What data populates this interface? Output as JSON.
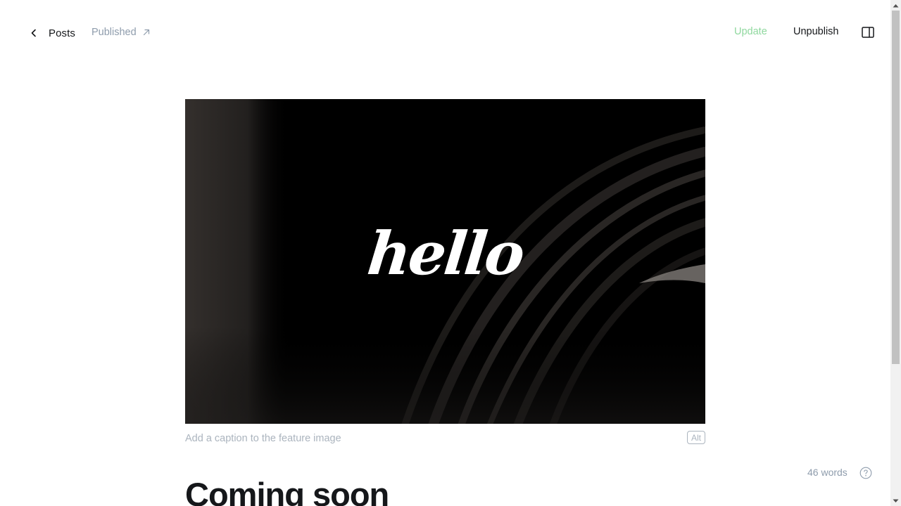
{
  "header": {
    "back_label": "Posts",
    "status_label": "Published",
    "update_label": "Update",
    "unpublish_label": "Unpublish"
  },
  "feature_image": {
    "overlay_text": "hello",
    "caption_placeholder": "Add a caption to the feature image",
    "alt_label": "Alt"
  },
  "post": {
    "title": "Coming soon"
  },
  "footer": {
    "word_count": "46 words"
  },
  "colors": {
    "accent_update": "#8fd89e",
    "muted_text": "#8e9cac",
    "primary_text": "#15171a"
  },
  "icons": {
    "back": "chevron-left-icon",
    "status": "arrow-up-right-icon",
    "sidebar": "sidebar-toggle-icon",
    "help": "question-circle-icon"
  }
}
